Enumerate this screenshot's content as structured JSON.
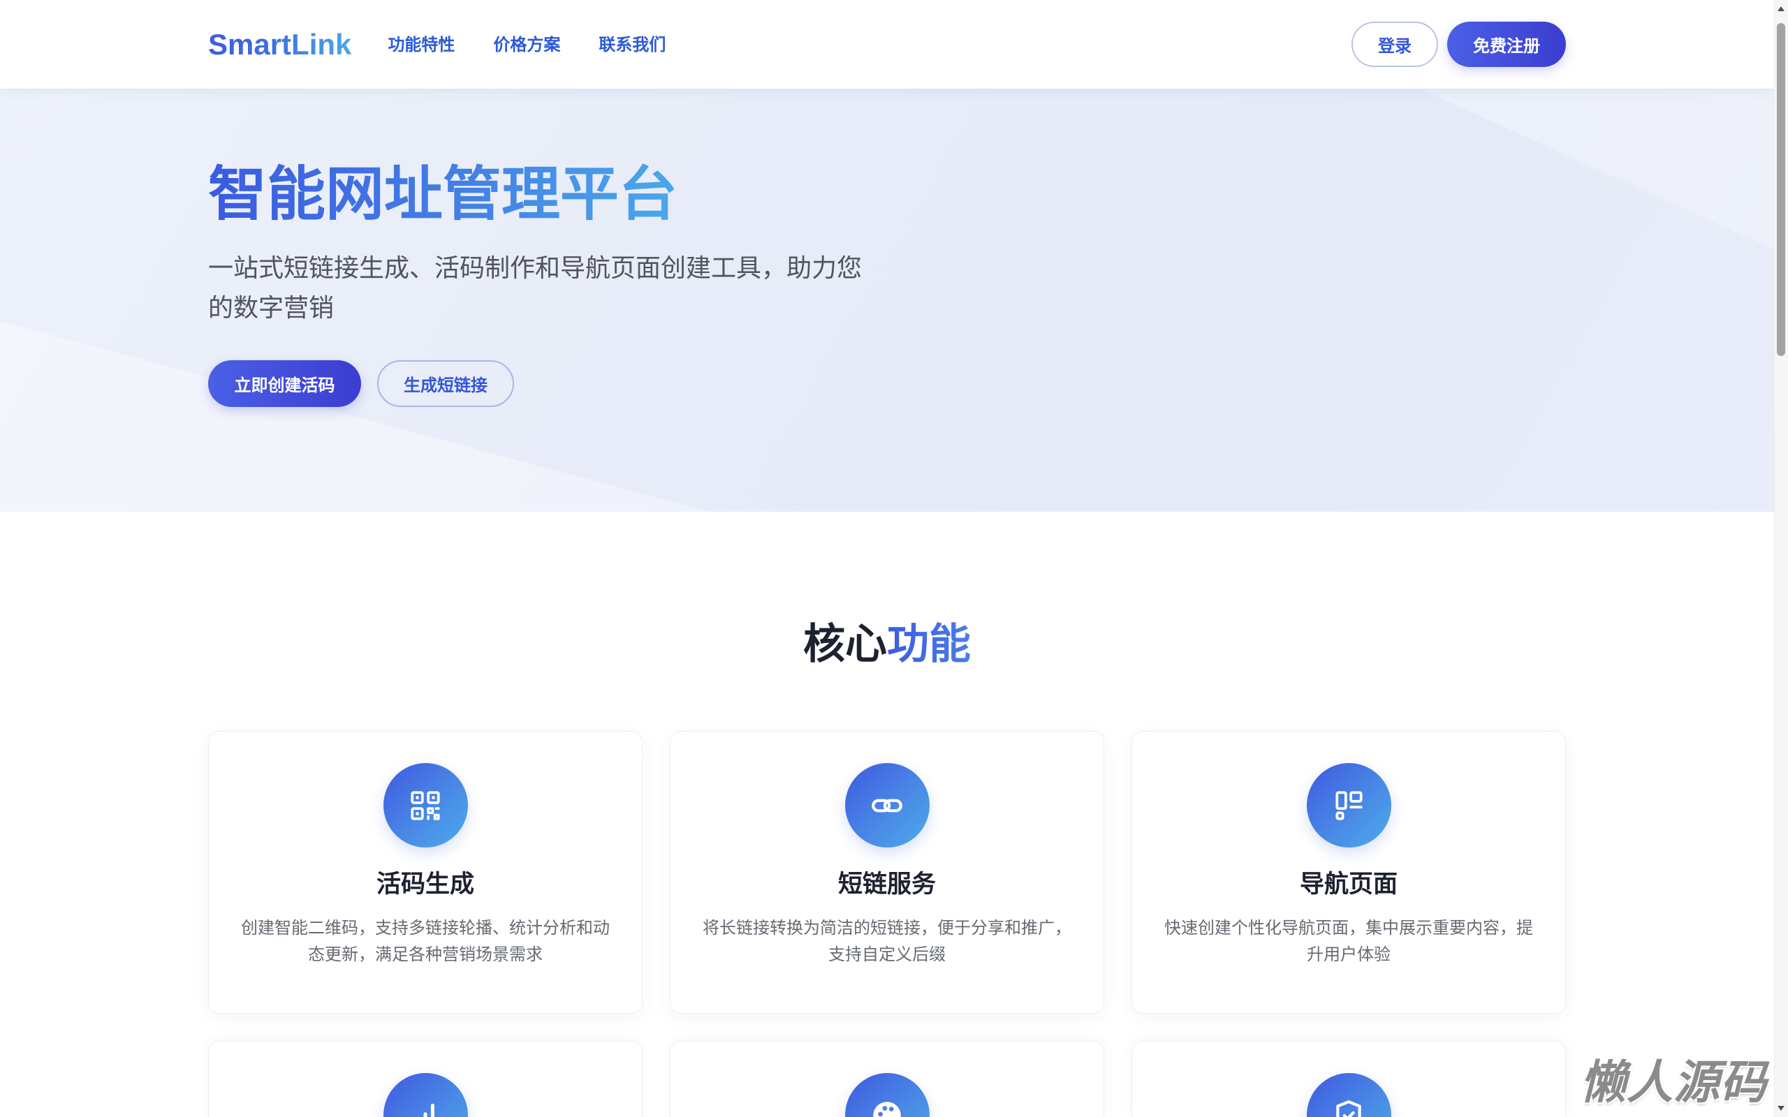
{
  "header": {
    "logo": "SmartLink",
    "nav": [
      {
        "label": "功能特性"
      },
      {
        "label": "价格方案"
      },
      {
        "label": "联系我们"
      }
    ],
    "login_label": "登录",
    "register_label": "免费注册"
  },
  "hero": {
    "title": "智能网址管理平台",
    "subtitle": "一站式短链接生成、活码制作和导航页面创建工具，助力您的数字营销",
    "primary_button": "立即创建活码",
    "secondary_button": "生成短链接"
  },
  "features": {
    "heading_dark": "核心",
    "heading_accent": "功能",
    "cards": [
      {
        "icon": "qr-code-icon",
        "title": "活码生成",
        "description": "创建智能二维码，支持多链接轮播、统计分析和动态更新，满足各种营销场景需求"
      },
      {
        "icon": "link-icon",
        "title": "短链服务",
        "description": "将长链接转换为简洁的短链接，便于分享和推广，支持自定义后缀"
      },
      {
        "icon": "layout-icon",
        "title": "导航页面",
        "description": "快速创建个性化导航页面，集中展示重要内容，提升用户体验"
      },
      {
        "icon": "bar-chart-icon"
      },
      {
        "icon": "palette-icon"
      },
      {
        "icon": "shield-check-icon"
      }
    ]
  },
  "watermark": "懒人源码",
  "colors": {
    "primary": "#3d5ce0",
    "accent": "#4aa9ea",
    "button_start": "#4a60e6",
    "button_end": "#3b3dd0",
    "nav_link": "#2c5ad6",
    "hero_background": "#e7ecf8",
    "heading_text": "#1e2230",
    "body_text": "#50545e"
  }
}
